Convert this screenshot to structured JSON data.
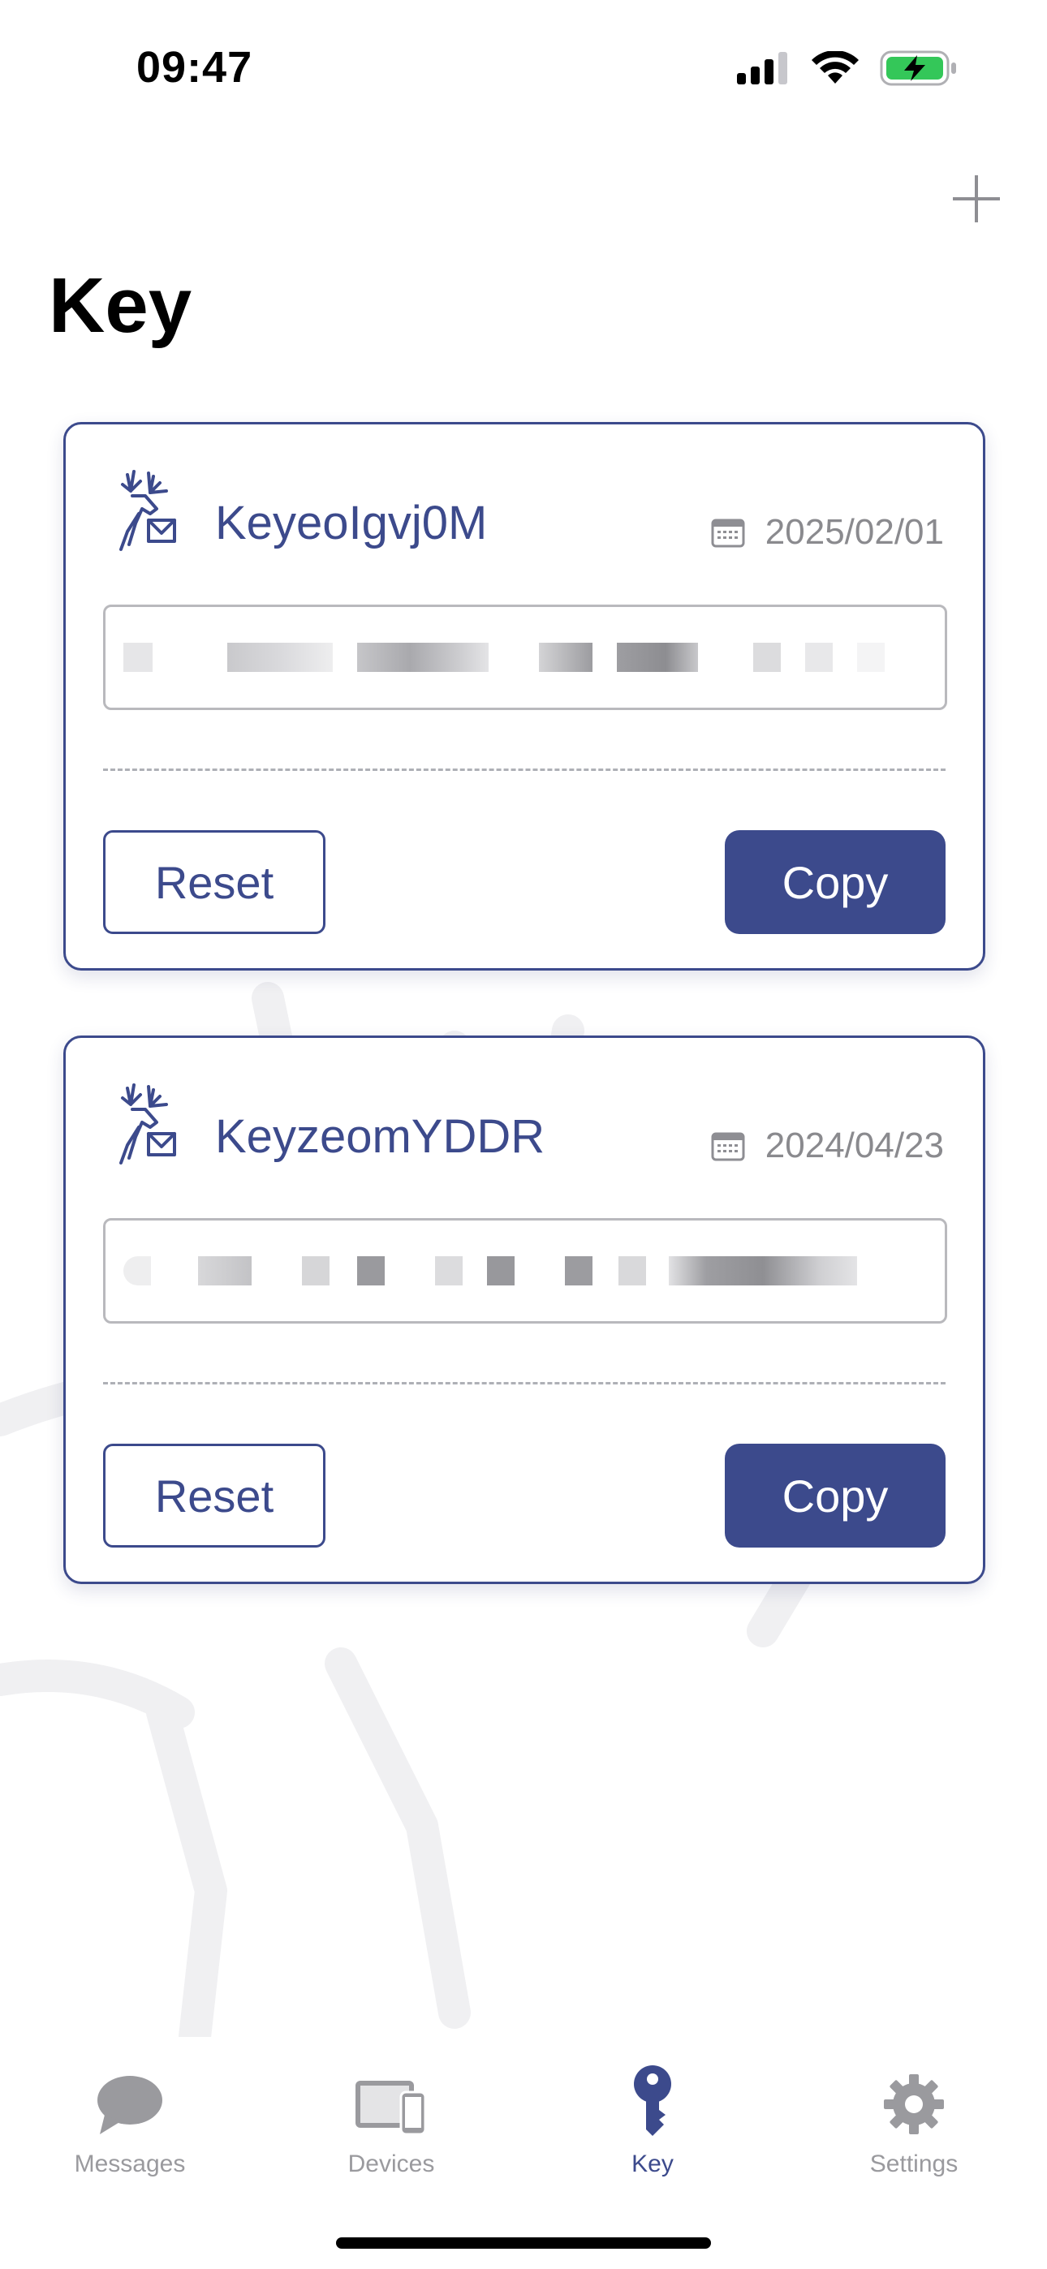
{
  "status_bar": {
    "time": "09:47"
  },
  "header": {
    "title": "Key"
  },
  "keys": [
    {
      "name": "KeyeoIgvj0M",
      "date": "2025/02/01",
      "reset_label": "Reset",
      "copy_label": "Copy"
    },
    {
      "name": "KeyzeomYDDR",
      "date": "2024/04/23",
      "reset_label": "Reset",
      "copy_label": "Copy"
    }
  ],
  "tab_bar": {
    "items": [
      {
        "label": "Messages",
        "icon": "chat-bubble-icon",
        "active": false
      },
      {
        "label": "Devices",
        "icon": "devices-icon",
        "active": false
      },
      {
        "label": "Key",
        "icon": "key-icon",
        "active": true
      },
      {
        "label": "Settings",
        "icon": "gear-icon",
        "active": false
      }
    ]
  },
  "colors": {
    "accent": "#3c4a8c",
    "inactive": "#9a9a9e",
    "battery": "#34c759"
  }
}
